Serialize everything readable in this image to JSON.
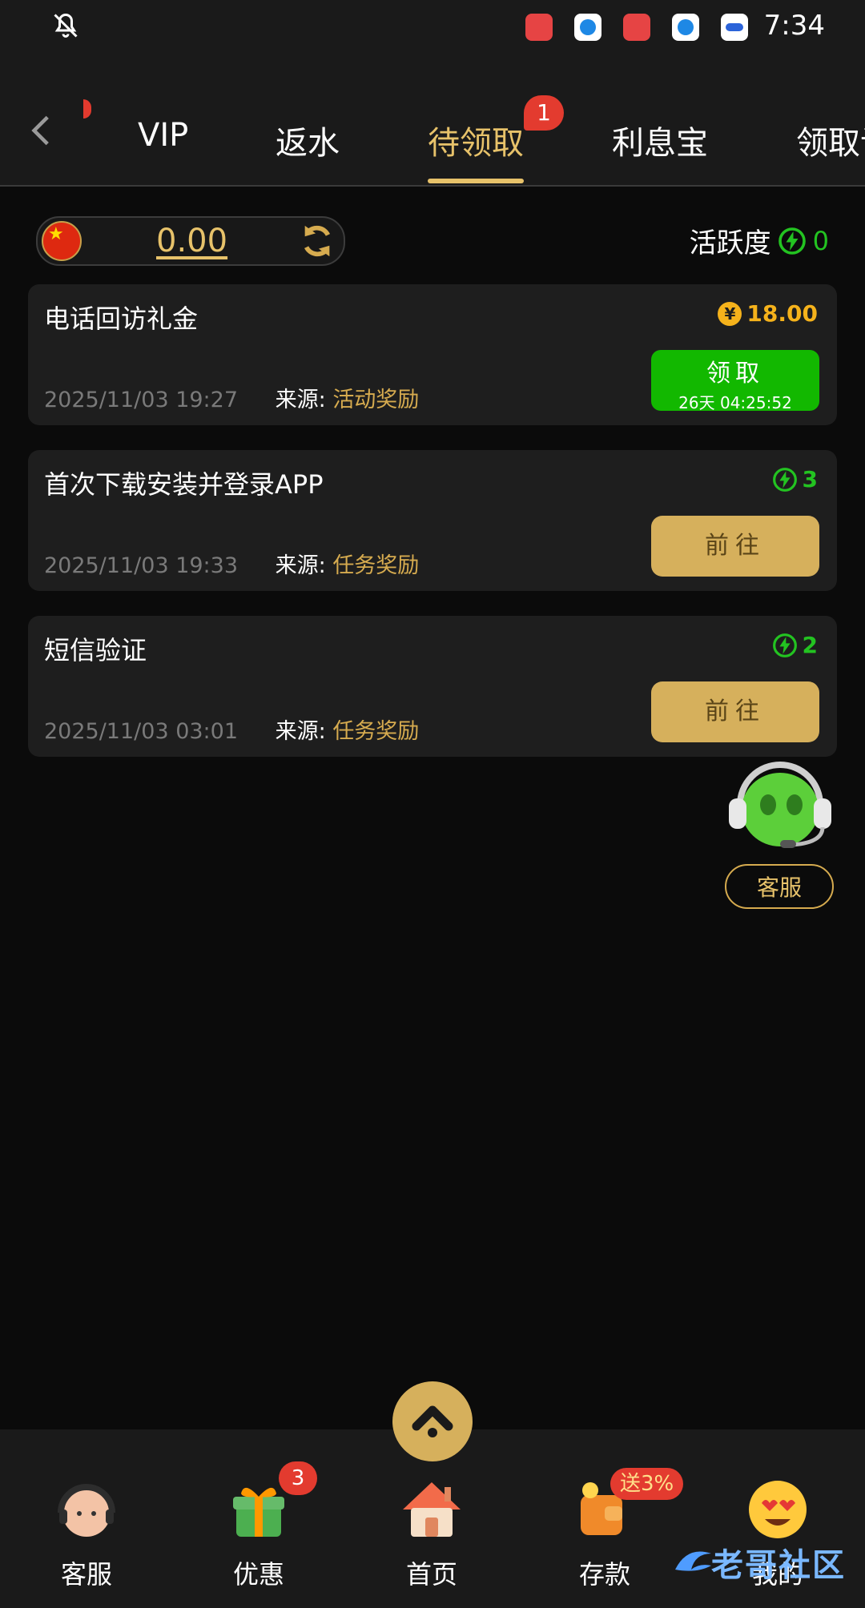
{
  "status_bar": {
    "time": "7:34"
  },
  "tabs": [
    {
      "label": "VIP"
    },
    {
      "label": "返水"
    },
    {
      "label": "待领取",
      "badge": "1",
      "active": true
    },
    {
      "label": "利息宝"
    },
    {
      "label": "领取记录"
    }
  ],
  "balance": {
    "value": "0.00"
  },
  "activity": {
    "label": "活跃度",
    "value": "0"
  },
  "cards": [
    {
      "title": "电话回访礼金",
      "reward": "18.00",
      "reward_type": "currency",
      "datetime": "2025/11/03 19:27",
      "source_label": "来源:",
      "source": "活动奖励",
      "button": "领取",
      "countdown": "26天 04:25:52"
    },
    {
      "title": "首次下载安装并登录APP",
      "reward": "3",
      "reward_type": "activity",
      "datetime": "2025/11/03 19:33",
      "source_label": "来源:",
      "source": "任务奖励",
      "button": "前往"
    },
    {
      "title": "短信验证",
      "reward": "2",
      "reward_type": "activity",
      "datetime": "2025/11/03 03:01",
      "source_label": "来源:",
      "source": "任务奖励",
      "button": "前往"
    }
  ],
  "customer_service": {
    "label": "客服"
  },
  "bottom_nav": [
    {
      "label": "客服"
    },
    {
      "label": "优惠",
      "badge": "3"
    },
    {
      "label": "首页"
    },
    {
      "label": "存款",
      "promo": "送3%"
    },
    {
      "label": "我的"
    }
  ],
  "watermark": {
    "text": "老哥社区"
  },
  "colors": {
    "accent": "#e7c26a",
    "green": "#12b800",
    "badge": "#e33b2f"
  }
}
